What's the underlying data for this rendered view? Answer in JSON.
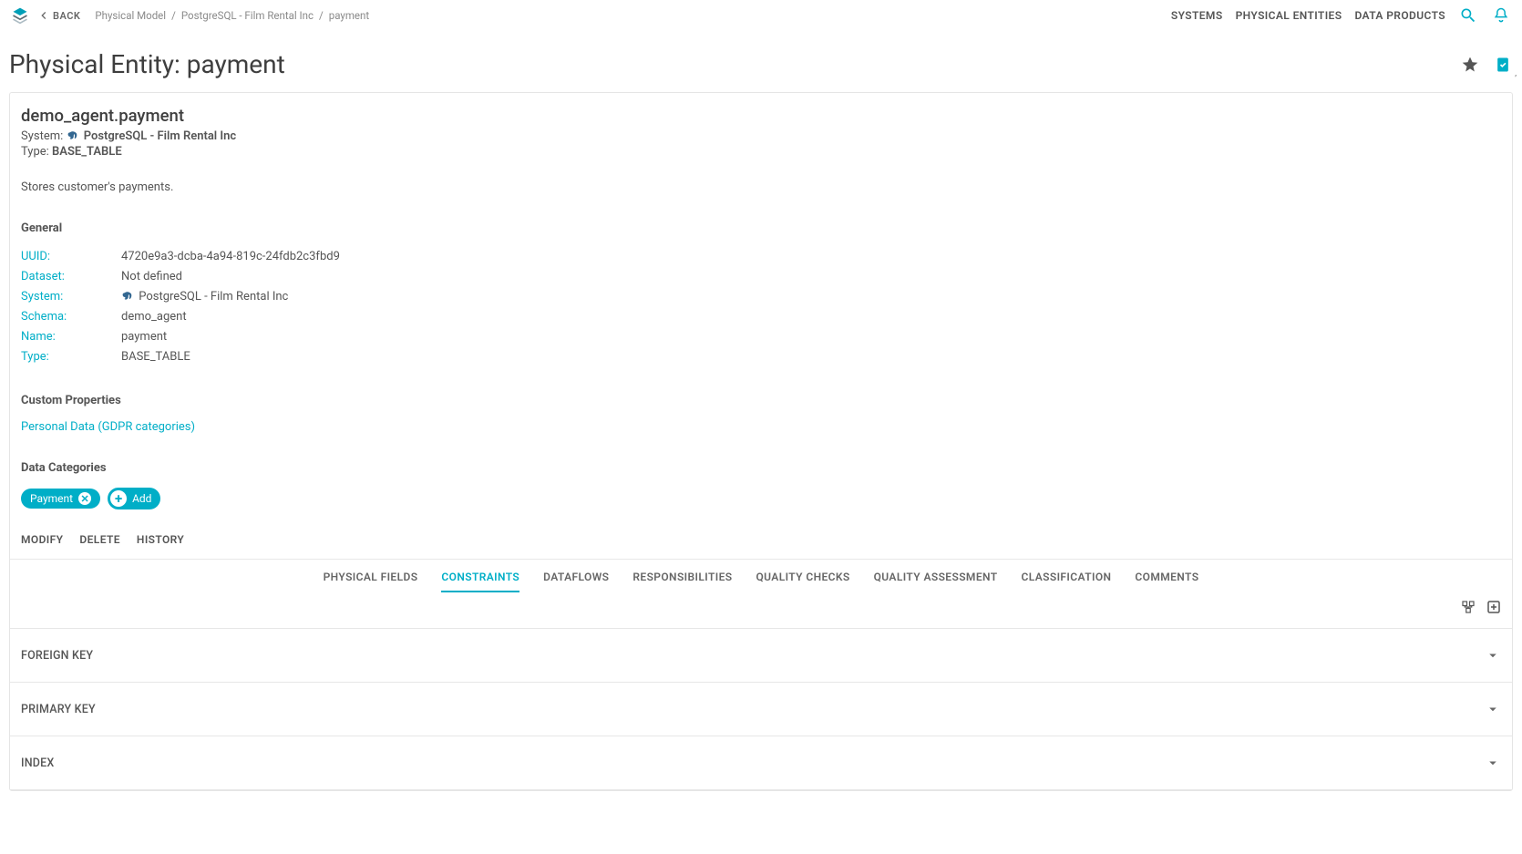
{
  "topbar": {
    "back_label": "BACK",
    "breadcrumbs": [
      "Physical Model",
      "PostgreSQL - Film Rental Inc",
      "payment"
    ],
    "nav": [
      "SYSTEMS",
      "PHYSICAL ENTITIES",
      "DATA PRODUCTS"
    ]
  },
  "page": {
    "title": "Physical Entity: payment"
  },
  "entity": {
    "qualified_name": "demo_agent.payment",
    "system_label": "System:",
    "system_value": "PostgreSQL - Film Rental Inc",
    "type_label": "Type:",
    "type_value": "BASE_TABLE",
    "description": "Stores customer's payments."
  },
  "sections": {
    "general_title": "General",
    "custom_props_title": "Custom Properties",
    "data_categories_title": "Data Categories"
  },
  "general": [
    {
      "key": "UUID:",
      "value": "4720e9a3-dcba-4a94-819c-24fdb2c3fbd9",
      "icon": false
    },
    {
      "key": "Dataset:",
      "value": "Not defined",
      "icon": false
    },
    {
      "key": "System:",
      "value": "PostgreSQL - Film Rental Inc",
      "icon": true
    },
    {
      "key": "Schema:",
      "value": "demo_agent",
      "icon": false
    },
    {
      "key": "Name:",
      "value": "payment",
      "icon": false
    },
    {
      "key": "Type:",
      "value": "BASE_TABLE",
      "icon": false
    }
  ],
  "custom_properties": {
    "link_label": "Personal Data (GDPR categories)"
  },
  "data_categories": {
    "chips": [
      "Payment"
    ],
    "add_label": "Add"
  },
  "entity_actions": [
    "MODIFY",
    "DELETE",
    "HISTORY"
  ],
  "tabs": {
    "items": [
      "PHYSICAL FIELDS",
      "CONSTRAINTS",
      "DATAFLOWS",
      "RESPONSIBILITIES",
      "QUALITY CHECKS",
      "QUALITY ASSESSMENT",
      "CLASSIFICATION",
      "COMMENTS"
    ],
    "active_index": 1
  },
  "accordion": [
    "FOREIGN KEY",
    "PRIMARY KEY",
    "INDEX"
  ],
  "colors": {
    "accent": "#00aec7"
  }
}
